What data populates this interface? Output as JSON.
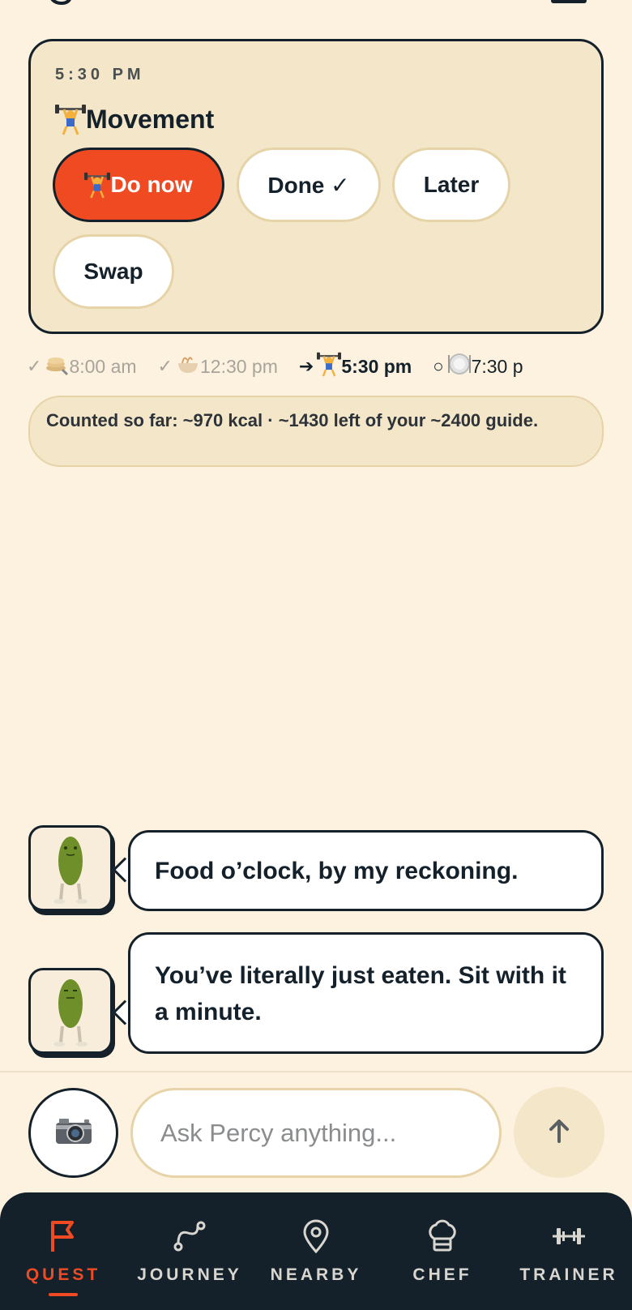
{
  "colors": {
    "background": "#fdf2df",
    "card": "#f4e6c8",
    "accent": "#f04a23",
    "ink": "#14212b",
    "nav_bg": "#14212b"
  },
  "quest": {
    "time": "5:30 PM",
    "title_icon": "weightlifter-icon",
    "title": "Movement",
    "actions": {
      "do_now": "Do now",
      "done": "Done ✓",
      "later": "Later",
      "swap": "Swap"
    }
  },
  "timeline": [
    {
      "status": "done",
      "mark": "✓",
      "icon": "pancake-icon",
      "time": "8:00 am"
    },
    {
      "status": "done",
      "mark": "✓",
      "icon": "noodle-bowl-icon",
      "time": "12:30 pm"
    },
    {
      "status": "current",
      "mark": "➔",
      "icon": "weightlifter-icon",
      "time": "5:30 pm"
    },
    {
      "status": "upcoming",
      "mark": "○",
      "icon": "plate-icon",
      "time": "7:30 p"
    }
  ],
  "kcal_banner": "Counted so far: ~970 kcal · ~1430 left of your ~2400 guide.",
  "messages": [
    {
      "sender_icon": "pickle-avatar-icon",
      "text": "Food o’clock, by my reckoning."
    },
    {
      "sender_icon": "pickle-avatar-icon",
      "text": "You’ve literally just eaten. Sit with it a minute."
    }
  ],
  "composer": {
    "placeholder": "Ask Percy anything...",
    "camera_icon": "camera-icon",
    "send_icon": "arrow-up-icon"
  },
  "nav": {
    "items": [
      {
        "label": "QUEST",
        "icon": "flag-icon",
        "active": true
      },
      {
        "label": "JOURNEY",
        "icon": "route-icon",
        "active": false
      },
      {
        "label": "NEARBY",
        "icon": "map-pin-icon",
        "active": false
      },
      {
        "label": "CHEF",
        "icon": "chef-hat-icon",
        "active": false
      },
      {
        "label": "TRAINER",
        "icon": "dumbbell-icon",
        "active": false
      }
    ]
  }
}
